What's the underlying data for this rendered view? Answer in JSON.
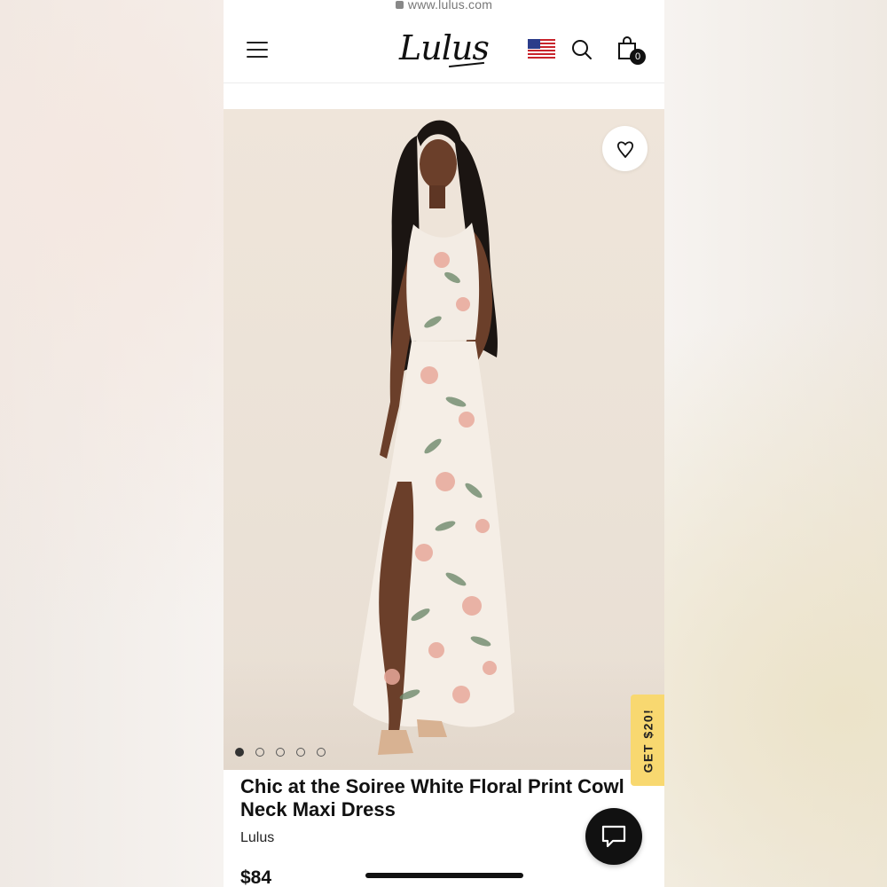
{
  "browser": {
    "url": "www.lulus.com"
  },
  "header": {
    "logo_text": "Lulus",
    "cart_count": "0",
    "icons": [
      "menu-icon",
      "us-flag-icon",
      "search-icon",
      "shopping-bag-icon"
    ]
  },
  "product": {
    "title_line1": "Chic at the Soiree White Floral Print Cowl",
    "title_line2": "Neck Maxi Dress",
    "brand": "Lulus",
    "price": "$84",
    "image_count": 5,
    "active_image": 1
  },
  "promo": {
    "label": "GET $20!",
    "color": "#f8d870"
  },
  "chat": {
    "icon": "chat-bubble-icon"
  },
  "colors": {
    "accent": "#111111",
    "promo": "#f8d870"
  }
}
